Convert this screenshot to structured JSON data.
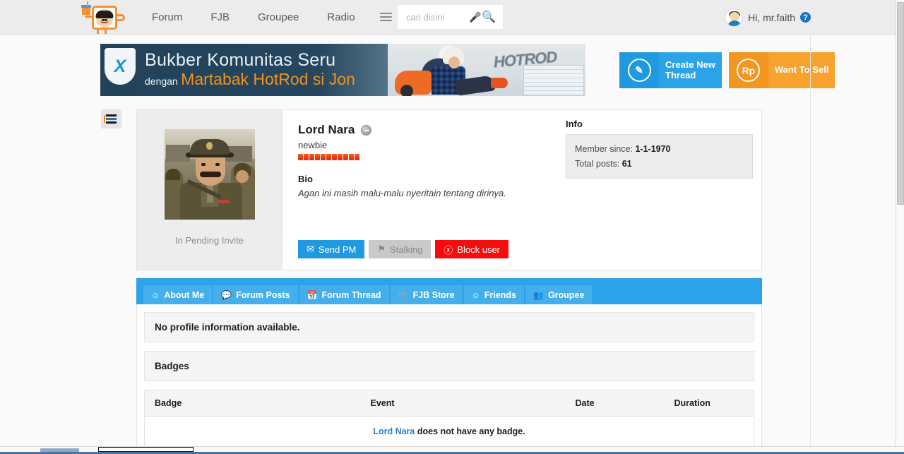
{
  "topbar": {
    "logo_icon": "kaskus-mascot-logo",
    "nav": [
      {
        "label": "Forum"
      },
      {
        "label": "FJB"
      },
      {
        "label": "Groupee"
      },
      {
        "label": "Radio"
      }
    ],
    "menu_icon": "hamburger-menu-icon",
    "search": {
      "placeholder": "cari disini",
      "value": "",
      "mic_icon": "microphone-icon",
      "submit_icon": "magnifier-icon"
    },
    "user": {
      "greeting": "Hi, mr.faith",
      "avatar_icon": "user-avatar",
      "help_icon": "question-mark-icon",
      "help_label": "?"
    }
  },
  "banner": {
    "brand_mark": "xl-shield-logo",
    "brand_letter": "X",
    "line1": "Bukber Komunitas Seru",
    "line2_prefix": "dengan",
    "line2_highlight": "Martabak HotRod si Jon",
    "sign_text": "HOTROD",
    "colors": {
      "bg_dark": "#22425a",
      "highlight": "#f0921e"
    }
  },
  "cta": {
    "create_thread": {
      "label": "Create New\nThread",
      "icon": "pencil-icon",
      "icon_glyph": "✎",
      "color": "#2ca3e8"
    },
    "want_to_sell": {
      "label": "Want To Sell",
      "icon": "rupiah-icon",
      "icon_glyph": "Rp",
      "color": "#f7a22c"
    }
  },
  "side_toggle": {
    "icon": "sidebar-toggle-icon"
  },
  "profile": {
    "avatar_alt": "profile-photo",
    "pending_label": "In Pending Invite",
    "name": "Lord Nara",
    "status_icon": "offline-status-icon",
    "rank": "newbie",
    "reputation_blocks": 11,
    "reputation_color": "#e8380d",
    "bio_heading": "Bio",
    "bio_text": "Agan ini masih malu-malu nyeritain tentang dirinya.",
    "actions": {
      "send_pm": {
        "label": "Send PM",
        "icon": "envelope-icon",
        "glyph": "✉",
        "color": "#1f9ae0"
      },
      "stalking": {
        "label": "Stalking",
        "icon": "bookmark-icon",
        "glyph": "⚑",
        "color": "#c9c9c9"
      },
      "block_user": {
        "label": "Block user",
        "icon": "eye-slash-icon",
        "glyph": "ⓧ",
        "color": "#f50d0d"
      }
    },
    "info": {
      "heading": "Info",
      "member_since_label": "Member since:",
      "member_since_value": "1-1-1970",
      "total_posts_label": "Total posts:",
      "total_posts_value": "61"
    }
  },
  "tabs": [
    {
      "label": "About Me",
      "icon": "avatar-icon",
      "glyph": "☺",
      "active": true
    },
    {
      "label": "Forum Posts",
      "icon": "comment-icon",
      "glyph": "💬",
      "active": false
    },
    {
      "label": "Forum Thread",
      "icon": "calendar-icon",
      "glyph": "📅",
      "active": false
    },
    {
      "label": "FJB Store",
      "icon": "cart-icon",
      "glyph": "🛒",
      "active": false
    },
    {
      "label": "Friends",
      "icon": "person-icon",
      "glyph": "☺",
      "active": false
    },
    {
      "label": "Groupee",
      "icon": "group-icon",
      "glyph": "👥",
      "active": false
    }
  ],
  "content": {
    "no_profile_info": "No profile information available.",
    "badges_heading": "Badges",
    "badges_table": {
      "columns": [
        "Badge",
        "Event",
        "Date",
        "Duration"
      ],
      "empty_link": "Lord Nara",
      "empty_text": " does not have any badge."
    }
  }
}
